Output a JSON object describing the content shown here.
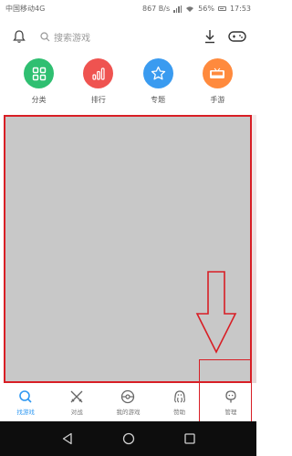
{
  "status_bar": {
    "carrier": "中国移动4G",
    "network_speed": "867 B/s",
    "battery": "56%",
    "time": "17:53"
  },
  "toolbar": {
    "search_placeholder": "搜索游戏",
    "icons": [
      "bell-icon",
      "search-icon",
      "download-icon",
      "gamepad-icon"
    ]
  },
  "categories": [
    {
      "label": "分类",
      "icon": "grid-icon",
      "color": "#2fbf71"
    },
    {
      "label": "排行",
      "icon": "bar-chart-icon",
      "color": "#ef5350"
    },
    {
      "label": "专题",
      "icon": "star-icon",
      "color": "#3a9bf0"
    },
    {
      "label": "手游",
      "icon": "handheld-icon",
      "color": "#ff8a3d"
    }
  ],
  "bottom_nav": {
    "items": [
      {
        "label": "找游戏",
        "icon": "search-icon",
        "active": true
      },
      {
        "label": "对战",
        "icon": "crossed-swords-icon",
        "active": false
      },
      {
        "label": "我的游戏",
        "icon": "pokeball-icon",
        "active": false
      },
      {
        "label": "赞助",
        "icon": "tentacle-icon",
        "active": false
      },
      {
        "label": "管理",
        "icon": "face-icon",
        "active": false
      }
    ],
    "active_color": "#2f98f2"
  },
  "annotation": {
    "color": "#d81e25"
  }
}
